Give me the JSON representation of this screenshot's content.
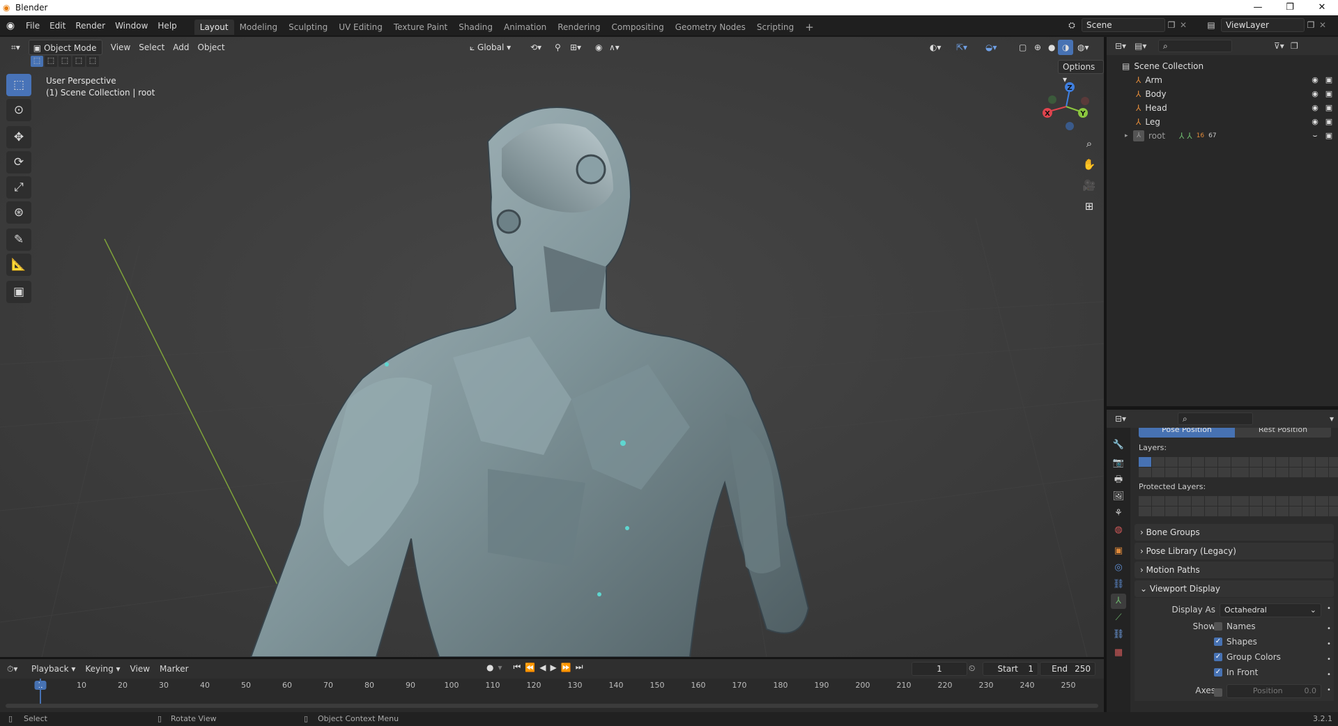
{
  "titlebar": {
    "app_name": "Blender",
    "minimize": "—",
    "maximize": "❐",
    "close": "✕"
  },
  "menu": [
    "File",
    "Edit",
    "Render",
    "Window",
    "Help"
  ],
  "workspaces": [
    "Layout",
    "Modeling",
    "Sculpting",
    "UV Editing",
    "Texture Paint",
    "Shading",
    "Animation",
    "Rendering",
    "Compositing",
    "Geometry Nodes",
    "Scripting"
  ],
  "scene_name": "Scene",
  "view_layer_name": "ViewLayer",
  "viewport": {
    "mode": "Object Mode",
    "menus": [
      "View",
      "Select",
      "Add",
      "Object"
    ],
    "orientation": "Global",
    "options_label": "Options",
    "overlay_line1": "User Perspective",
    "overlay_line2": "(1) Scene Collection | root",
    "gizmo_axes": [
      "Z",
      "X",
      "Y"
    ]
  },
  "outliner": {
    "collection": "Scene Collection",
    "items": [
      "Arm",
      "Body",
      "Head",
      "Leg"
    ],
    "root_item": "root",
    "root_badges": [
      "16",
      "67"
    ]
  },
  "properties": {
    "pose_tabs": [
      "Pose Position",
      "Rest Position"
    ],
    "layers_label": "Layers:",
    "protected_layers_label": "Protected Layers:",
    "panels": [
      "Bone Groups",
      "Pose Library (Legacy)",
      "Motion Paths",
      "Viewport Display"
    ],
    "display_as_label": "Display As",
    "display_as_value": "Octahedral",
    "show_label": "Show",
    "show_options": [
      {
        "label": "Names",
        "checked": false
      },
      {
        "label": "Shapes",
        "checked": true
      },
      {
        "label": "Group Colors",
        "checked": true
      },
      {
        "label": "In Front",
        "checked": true
      }
    ],
    "axes_label": "Axes",
    "axes_position_label": "Position",
    "axes_position_value": "0.0"
  },
  "timeline": {
    "menus": [
      "Playback",
      "Keying",
      "View",
      "Marker"
    ],
    "current_frame": "1",
    "start_label": "Start",
    "start_value": "1",
    "end_label": "End",
    "end_value": "250",
    "ruler": [
      "1",
      "10",
      "20",
      "30",
      "40",
      "50",
      "60",
      "70",
      "80",
      "90",
      "100",
      "110",
      "120",
      "130",
      "140",
      "150",
      "160",
      "170",
      "180",
      "190",
      "200",
      "210",
      "220",
      "230",
      "240",
      "250"
    ]
  },
  "statusbar": {
    "select": "Select",
    "rotate": "Rotate View",
    "context": "Object Context Menu",
    "version": "3.2.1"
  },
  "colors": {
    "accent": "#4772b3",
    "viewport_bg": "#3d3d3d",
    "axis_x": "#e0444e",
    "axis_y": "#8bc63f",
    "axis_z": "#3f7fe0"
  }
}
